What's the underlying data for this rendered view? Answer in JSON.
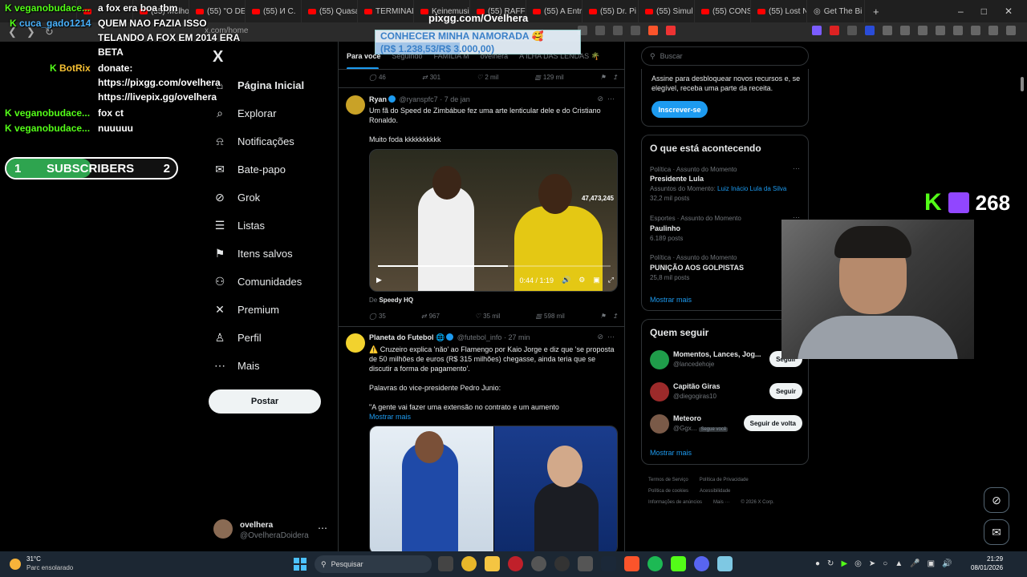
{
  "browser": {
    "tabs": [
      {
        "label": "(55) Melho"
      },
      {
        "label": "(55) \"O DE"
      },
      {
        "label": "(55) И С."
      },
      {
        "label": "(55) Quasa"
      },
      {
        "label": "TERMINAL"
      },
      {
        "label": "Keinemusi"
      },
      {
        "label": "(55) RAFFL"
      },
      {
        "label": "(55) A Entr"
      },
      {
        "label": "(55) Dr. Pi"
      },
      {
        "label": "(55) Simul"
      },
      {
        "label": "(55) CONS"
      },
      {
        "label": "(55) Lost N"
      },
      {
        "label": "Get The Bi"
      }
    ],
    "new_tab": "+",
    "url": "x.com/home",
    "win_controls": [
      "–",
      "□",
      "✕"
    ]
  },
  "overlay": {
    "chat": [
      {
        "user": "veganobudace...",
        "msg": "a fox era boa tbm"
      },
      {
        "user": "cuca_gado1214",
        "msg": "QUEM NAO FAZIA ISSO TELANDO A FOX EM 2014 ERA BETA"
      },
      {
        "user": "BotRix",
        "msg": "donate: https://pixgg.com/ovelhera https://livepix.gg/ovelhera"
      },
      {
        "user": "veganobudace...",
        "msg": "fox ct"
      },
      {
        "user": "veganobudace...",
        "msg": "nuuuuu"
      }
    ],
    "chat_lines": {
      "l1": "a fox era boa tbm",
      "l2a": "QUEM NAO FAZIA ISSO",
      "l2b": "TELANDO A FOX EM 2014 ERA",
      "l2c": "BETA",
      "l3a": "donate:",
      "l3b": "https://pixgg.com/ovelhera",
      "l3c": "https://livepix.gg/ovelhera"
    },
    "subs": {
      "label": "SUBSCRIBERS",
      "current": "1",
      "goal": "2",
      "progress": 0.5
    },
    "pix": {
      "title": "pixgg.com/Ovelhera",
      "goal_title": "CONHECER MINHA NAMORADA 🥰",
      "goal_amount": "(R$ 1.238,53/R$ 3.000,00)",
      "progress": 0.41
    },
    "viewers": "268",
    "kick_k": "K"
  },
  "x": {
    "logo": "X",
    "nav": [
      {
        "label": "Página Inicial",
        "icon": "home-icon",
        "glyph": "⌂"
      },
      {
        "label": "Explorar",
        "icon": "search-icon",
        "glyph": "⌕"
      },
      {
        "label": "Notificações",
        "icon": "bell-icon",
        "glyph": "⍾"
      },
      {
        "label": "Bate-papo",
        "icon": "mail-icon",
        "glyph": "✉"
      },
      {
        "label": "Grok",
        "icon": "grok-icon",
        "glyph": "⊘"
      },
      {
        "label": "Listas",
        "icon": "list-icon",
        "glyph": "☰"
      },
      {
        "label": "Itens salvos",
        "icon": "bookmark-icon",
        "glyph": "⚑"
      },
      {
        "label": "Comunidades",
        "icon": "communities-icon",
        "glyph": "⚇"
      },
      {
        "label": "Premium",
        "icon": "x-premium-icon",
        "glyph": "✕"
      },
      {
        "label": "Perfil",
        "icon": "person-icon",
        "glyph": "♙"
      },
      {
        "label": "Mais",
        "icon": "more-circle-icon",
        "glyph": "⋯"
      }
    ],
    "post_button": "Postar",
    "account": {
      "name": "ovelhera",
      "handle": "@OvelheraDoidera",
      "more": "⋯"
    },
    "tabs": [
      "Para você",
      "Seguindo",
      "FAMILIA M",
      "ovelhera",
      "A ILHA DAS LENDAS 🌴"
    ],
    "top_actions": {
      "replies": "46",
      "reposts": "301",
      "likes": "2 mil",
      "views": "129 mil"
    },
    "tweet1": {
      "name": "Ryan",
      "handle": "@ryanspfc7",
      "time": "7 de jan",
      "text": "Um fã do Speed de Zimbábue fez uma arte lenticular dele e do Cristiano Ronaldo.",
      "text2": "Muito foda kkkkkkkkkk",
      "video_counter": "47,473,245",
      "video_time": "0:44 / 1:19",
      "video_progress": 0.56,
      "from_label": "De",
      "from_source": "Speedy HQ",
      "actions": {
        "replies": "35",
        "reposts": "967",
        "likes": "35 mil",
        "views": "598 mil"
      }
    },
    "tweet2": {
      "name": "Planeta do Futebol",
      "handle": "@futebol_info",
      "time": "27 min",
      "text": "⚠️ Cruzeiro explica 'não' ao Flamengo por Kaio Jorge e diz que 'se proposta de 50 milhões de euros (R$ 315 milhões) chegasse, ainda teria que se discutir a forma de pagamento'.",
      "text2": "Palavras do vice-presidente Pedro Junio:",
      "text3": "\"A gente vai fazer uma extensão no contrato e um aumento",
      "show_more": "Mostrar mais"
    },
    "search_placeholder": "Buscar",
    "premium_box": {
      "text": "Assine para desbloquear novos recursos e, se elegível, receba uma parte da receita.",
      "button": "Inscrever-se"
    },
    "trends": {
      "title": "O que está acontecendo",
      "items": [
        {
          "category": "Política · Assunto do Momento",
          "name": "Presidente Lula",
          "extra_prefix": "Assuntos do Momento: ",
          "extra_link": "Luiz Inácio Lula da Silva",
          "posts": "32,2 mil posts"
        },
        {
          "category": "Esportes · Assunto do Momento",
          "name": "Paulinho",
          "posts": "6.189 posts"
        },
        {
          "category": "Política · Assunto do Momento",
          "name": "PUNIÇÃO AOS GOLPISTAS",
          "posts": "25,8 mil posts"
        }
      ],
      "show_more": "Mostrar mais"
    },
    "who_to_follow": {
      "title": "Quem seguir",
      "items": [
        {
          "name": "Momentos, Lances, Jog...",
          "handle": "@lancedehoje",
          "button": "Seguir",
          "color": "#1f9d4a"
        },
        {
          "name": "Capitão Giras",
          "handle": "@diegogiras10",
          "button": "Seguir",
          "color": "#9c2a2a"
        },
        {
          "name": "Meteoro",
          "handle": "@Ggx...",
          "badge": "Segue você",
          "button": "Seguir de volta",
          "color": "#7a5a48"
        }
      ],
      "show_more": "Mostrar mais"
    },
    "footer": [
      "Termos de Serviço",
      "Política de Privacidade",
      "Política de cookies",
      "Acessibilidade",
      "Informações de anúncios",
      "Mais ···",
      "© 2026 X Corp."
    ]
  },
  "taskbar": {
    "temp": "31°C",
    "weather": "Parc ensolarado",
    "search": "Pesquisar",
    "time": "21:29",
    "date": "08/01/2026"
  },
  "colors": {
    "accent": "#1d9bf0",
    "kick": "#53fc18",
    "twitch": "#9146ff"
  }
}
